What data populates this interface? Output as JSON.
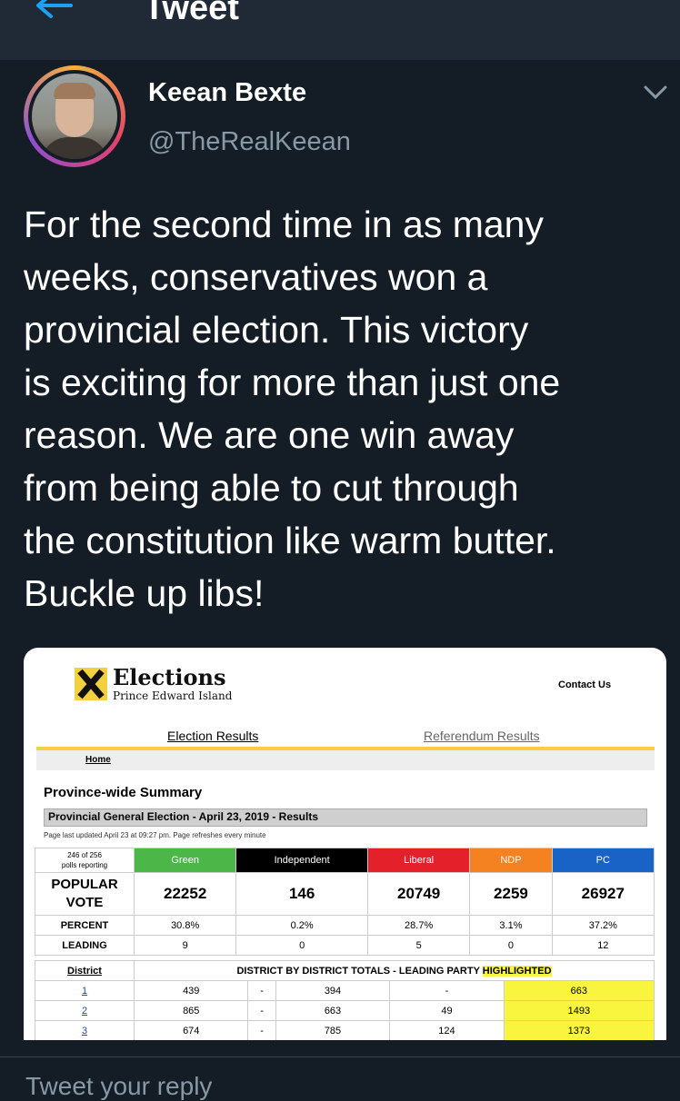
{
  "header": {
    "title": "Tweet",
    "back_icon": "arrow-left-icon"
  },
  "author": {
    "name": "Keean Bexte",
    "handle": "@TheRealKeean"
  },
  "tweet": {
    "text": "For the second time in as many\nweeks, conservatives won a\nprovincial election. This victory\nis exciting for more than just one\nreason. We are one win away\nfrom being able to cut through\nthe constitution like warm butter.\nBuckle up libs!"
  },
  "media": {
    "logo_title": "Elections",
    "logo_sub": "Prince Edward Island",
    "contact": "Contact Us",
    "nav": {
      "election_results": "Election Results",
      "referendum_results": "Referendum Results",
      "home": "Home"
    },
    "summary_title": "Province-wide Summary",
    "election_header": "Provincial General Election - April 23, 2019 - Results",
    "updated": "Page last updated April 23 at 09:27 pm. Page refreshes every minute",
    "polls": {
      "line1": "246 of 256",
      "line2": "polls reporting"
    },
    "parties": [
      {
        "name": "Green",
        "color": "#4cb648"
      },
      {
        "name": "Independent",
        "color": "#000000"
      },
      {
        "name": "Liberal",
        "color": "#e4212b"
      },
      {
        "name": "NDP",
        "color": "#f58220"
      },
      {
        "name": "PC",
        "color": "#1a63c6"
      }
    ],
    "popular_vote": {
      "label1": "POPULAR",
      "label2": "VOTE",
      "values": [
        "22252",
        "146",
        "20749",
        "2259",
        "26927"
      ]
    },
    "percent": {
      "label": "PERCENT",
      "values": [
        "30.8%",
        "0.2%",
        "28.7%",
        "3.1%",
        "37.2%"
      ]
    },
    "leading": {
      "label": "LEADING",
      "values": [
        "9",
        "0",
        "5",
        "0",
        "12"
      ]
    },
    "district": {
      "header": "District",
      "title": "DISTRICT BY DISTRICT TOTALS - LEADING PARTY ",
      "highlighted": "HIGHLIGHTED",
      "rows": [
        {
          "id": "1",
          "values": [
            "439",
            "-",
            "394",
            "-",
            "663"
          ]
        },
        {
          "id": "2",
          "values": [
            "865",
            "-",
            "663",
            "49",
            "1493"
          ]
        },
        {
          "id": "3",
          "values": [
            "674",
            "-",
            "785",
            "124",
            "1373"
          ]
        }
      ]
    }
  },
  "reply": {
    "placeholder": "Tweet your reply"
  }
}
